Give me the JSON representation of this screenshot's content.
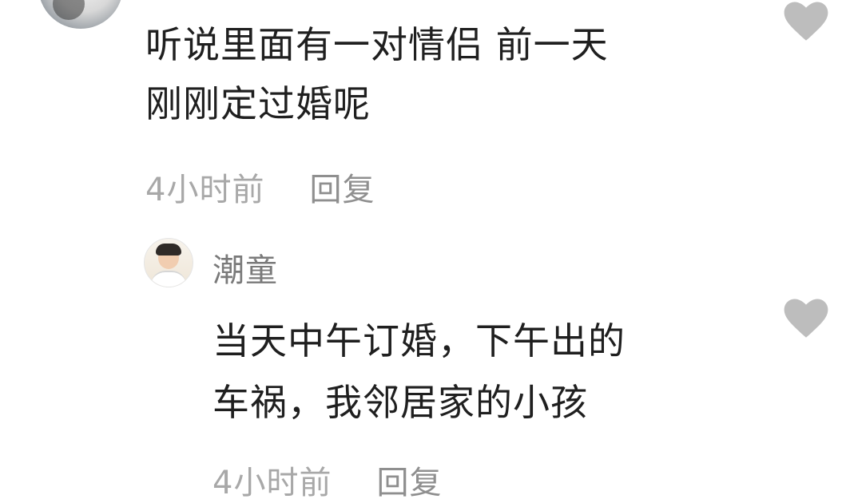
{
  "comment": {
    "text_line1": "听说里面有一对情侣 前一天",
    "text_line2": "刚刚定过婚呢",
    "time": "4小时前",
    "reply_label": "回复",
    "like_icon": "heart-icon"
  },
  "reply": {
    "username": "潮童",
    "text_line1": "当天中午订婚，下午出的",
    "text_line2": "车祸，我邻居家的小孩",
    "time": "4小时前",
    "reply_label": "回复",
    "like_icon": "heart-icon"
  },
  "colors": {
    "text": "#1f1f1f",
    "meta": "#a8a8a8",
    "heart": "#bdbdbd"
  }
}
